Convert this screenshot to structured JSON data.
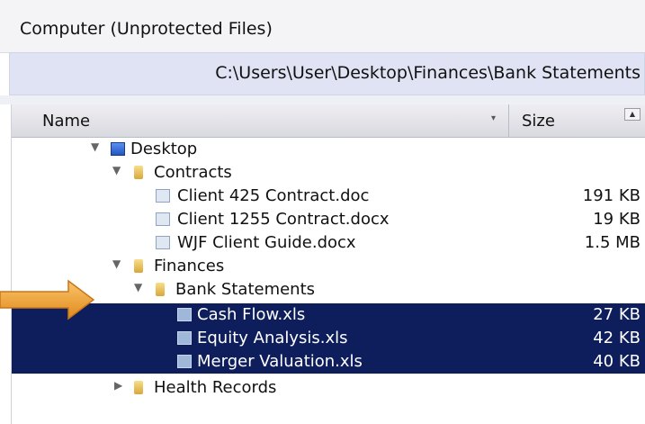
{
  "panel": {
    "title": "Computer (Unprotected Files)"
  },
  "path": {
    "value": "C:\\Users\\User\\Desktop\\Finances\\Bank Statements"
  },
  "columns": {
    "name": "Name",
    "size": "Size"
  },
  "rows": [
    {
      "name": "Desktop",
      "size": "",
      "icon": "desktop-icon",
      "expanded": true,
      "selected": false
    },
    {
      "name": "Contracts",
      "size": "",
      "icon": "folder-icon",
      "expanded": true,
      "selected": false
    },
    {
      "name": "Client 425 Contract.doc",
      "size": "191 KB",
      "icon": "document-icon",
      "selected": false
    },
    {
      "name": "Client 1255 Contract.docx",
      "size": "19 KB",
      "icon": "document-icon",
      "selected": false
    },
    {
      "name": "WJF Client Guide.docx",
      "size": "1.5 MB",
      "icon": "document-icon",
      "selected": false
    },
    {
      "name": "Finances",
      "size": "",
      "icon": "folder-icon",
      "expanded": true,
      "selected": false
    },
    {
      "name": "Bank Statements",
      "size": "",
      "icon": "folder-icon",
      "expanded": true,
      "selected": false
    },
    {
      "name": "Cash Flow.xls",
      "size": "27 KB",
      "icon": "spreadsheet-icon",
      "selected": true
    },
    {
      "name": "Equity Analysis.xls",
      "size": "42 KB",
      "icon": "spreadsheet-icon",
      "selected": true
    },
    {
      "name": "Merger Valuation.xls",
      "size": "40 KB",
      "icon": "spreadsheet-icon",
      "selected": true
    },
    {
      "name": "Health Records",
      "size": "",
      "icon": "folder-icon",
      "expanded": false,
      "selected": false
    }
  ],
  "colors": {
    "selection": "#0e1e5c",
    "path_bar": "#dfe3f4",
    "arrow": "#f0a030"
  }
}
